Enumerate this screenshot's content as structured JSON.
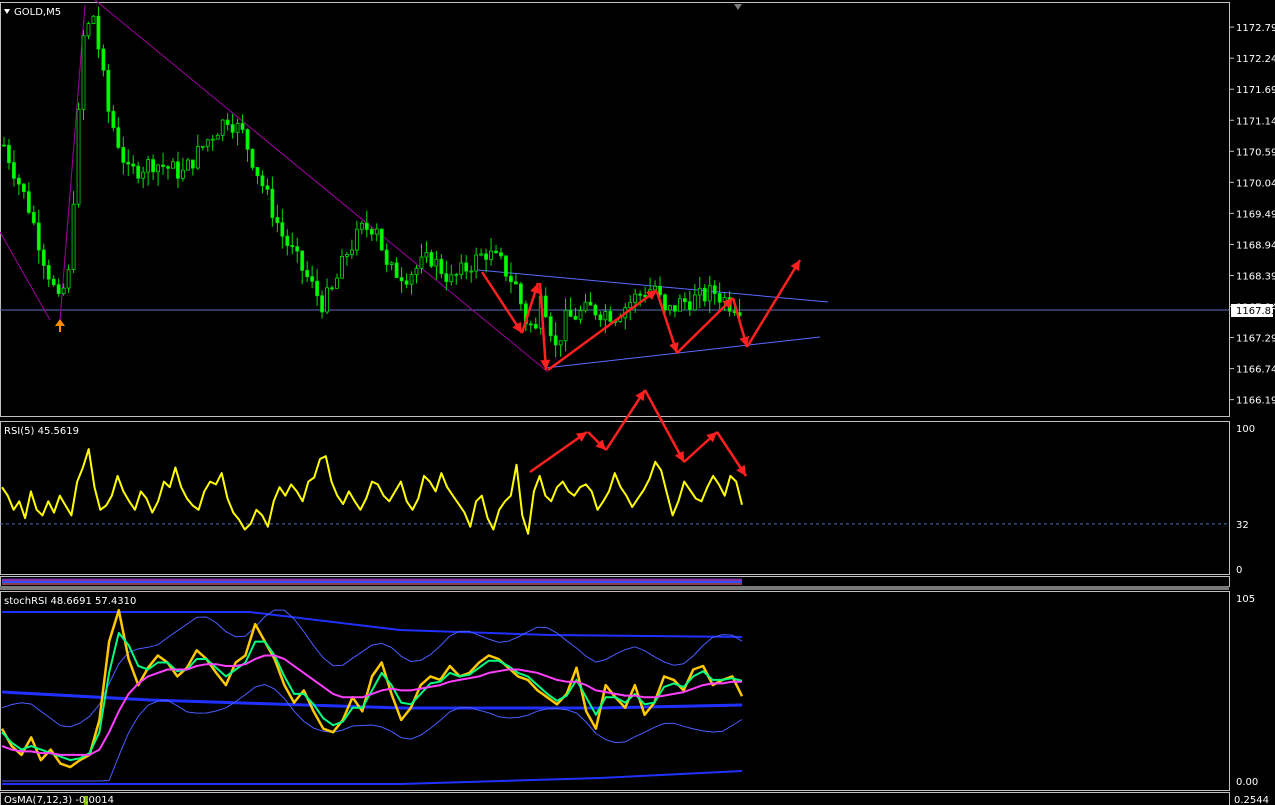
{
  "colors": {
    "background": "#000000",
    "frame": "#c0c0c0",
    "candle_up": "#00e000",
    "candle_down": "#00ff00",
    "trendline_blue": "#5a6aff",
    "trendline_magenta": "#a000a0",
    "bid_line": "#6070c0",
    "annotation_arrow": "#ff2020",
    "rsi_line": "#ffff00",
    "stoch_yellow": "#ffc800",
    "stoch_green": "#00ff80",
    "stoch_magenta": "#ff40ff",
    "stoch_band_thin": "#4a5cff",
    "stoch_band_thick": "#2030ff"
  },
  "chart_data": [
    {
      "type": "candlestick",
      "title": "GOLD,M5",
      "symbol": "GOLD",
      "timeframe": "M5",
      "ylim": [
        1165.9,
        1173.2
      ],
      "y_ticks": [
        1172.79,
        1172.24,
        1171.69,
        1171.14,
        1170.59,
        1170.04,
        1169.49,
        1168.94,
        1168.39,
        1167.84,
        1167.29,
        1166.74,
        1166.19
      ],
      "current_price_label": "1167.83",
      "current_price": 1167.83,
      "close_path": [
        [
          0,
          1170.7
        ],
        [
          5,
          1169.6
        ],
        [
          8,
          1168.7
        ],
        [
          11,
          1167.9
        ],
        [
          13,
          1168.4
        ],
        [
          16,
          1172.6
        ],
        [
          18,
          1173.0
        ],
        [
          21,
          1171.3
        ],
        [
          25,
          1170.2
        ],
        [
          30,
          1170.4
        ],
        [
          36,
          1170.2
        ],
        [
          41,
          1170.8
        ],
        [
          45,
          1171.2
        ],
        [
          48,
          1170.9
        ],
        [
          52,
          1170.0
        ],
        [
          56,
          1169.1
        ],
        [
          60,
          1168.5
        ],
        [
          64,
          1167.9
        ],
        [
          66,
          1168.1
        ],
        [
          69,
          1168.8
        ],
        [
          72,
          1169.2
        ],
        [
          75,
          1169.3
        ],
        [
          77,
          1168.5
        ],
        [
          81,
          1168.4
        ],
        [
          86,
          1168.7
        ],
        [
          90,
          1168.3
        ],
        [
          94,
          1168.6
        ],
        [
          97,
          1168.8
        ],
        [
          100,
          1168.6
        ],
        [
          103,
          1168.2
        ],
        [
          105,
          1167.6
        ],
        [
          107,
          1167.4
        ],
        [
          108,
          1168.2
        ],
        [
          111,
          1167.1
        ],
        [
          113,
          1167.6
        ],
        [
          118,
          1167.8
        ],
        [
          123,
          1167.7
        ],
        [
          127,
          1168.0
        ],
        [
          131,
          1168.2
        ],
        [
          133,
          1167.7
        ],
        [
          136,
          1167.9
        ],
        [
          140,
          1168.0
        ],
        [
          143,
          1168.1
        ],
        [
          146,
          1167.9
        ],
        [
          148,
          1167.85
        ]
      ],
      "annotations": {
        "trend_lines": "descending line from high, converging triangle lines",
        "arrows": "red zig-zag projection arrows"
      }
    },
    {
      "type": "line",
      "title": "RSI(5) 45.5619",
      "ylim": [
        0,
        100
      ],
      "y_ticks": [
        100,
        32,
        0
      ],
      "level_line": 32,
      "series": [
        {
          "name": "RSI(5)",
          "values": [
            58,
            52,
            42,
            48,
            36,
            55,
            42,
            38,
            48,
            40,
            52,
            45,
            38,
            62,
            72,
            85,
            58,
            42,
            45,
            52,
            66,
            55,
            48,
            42,
            55,
            50,
            40,
            48,
            62,
            58,
            72,
            58,
            50,
            45,
            42,
            55,
            62,
            60,
            68,
            50,
            40,
            35,
            28,
            32,
            42,
            38,
            30,
            48,
            58,
            52,
            60,
            55,
            48,
            62,
            65,
            78,
            80,
            62,
            52,
            46,
            55,
            48,
            42,
            50,
            62,
            60,
            52,
            48,
            55,
            62,
            48,
            42,
            50,
            66,
            62,
            55,
            68,
            58,
            52,
            46,
            40,
            30,
            48,
            52,
            36,
            28,
            42,
            48,
            52,
            74,
            38,
            25,
            55,
            66,
            52,
            48,
            58,
            62,
            55,
            52,
            58,
            60,
            55,
            42,
            48,
            55,
            68,
            58,
            52,
            44,
            50,
            56,
            64,
            76,
            70,
            54,
            38,
            48,
            62,
            56,
            50,
            48,
            58,
            66,
            60,
            52,
            66,
            62,
            45.56
          ]
        }
      ]
    },
    {
      "type": "line",
      "title": "stochRSI 48.6691 57.4310",
      "ylim": [
        0,
        105
      ],
      "y_ticks": [
        105,
        0
      ],
      "series": [
        {
          "name": "fast",
          "values": [
            30,
            20,
            15,
            25,
            12,
            18,
            10,
            8,
            12,
            15,
            35,
            80,
            98,
            70,
            55,
            65,
            72,
            68,
            60,
            65,
            75,
            70,
            62,
            55,
            68,
            72,
            90,
            80,
            70,
            55,
            45,
            52,
            40,
            30,
            28,
            35,
            48,
            40,
            60,
            68,
            50,
            35,
            42,
            55,
            60,
            58,
            66,
            60,
            62,
            68,
            72,
            70,
            65,
            60,
            58,
            52,
            48,
            44,
            50,
            65,
            40,
            30,
            55,
            48,
            42,
            55,
            38,
            45,
            60,
            58,
            52,
            64,
            66,
            55,
            58,
            60,
            48.67
          ]
        },
        {
          "name": "signal",
          "values": [
            28,
            22,
            18,
            20,
            18,
            16,
            14,
            12,
            13,
            16,
            28,
            62,
            85,
            78,
            66,
            64,
            68,
            68,
            63,
            64,
            70,
            70,
            65,
            60,
            64,
            68,
            80,
            80,
            72,
            60,
            50,
            50,
            44,
            36,
            32,
            34,
            42,
            42,
            52,
            62,
            55,
            45,
            44,
            50,
            56,
            57,
            62,
            60,
            61,
            65,
            69,
            69,
            66,
            62,
            60,
            55,
            50,
            46,
            49,
            58,
            48,
            38,
            48,
            48,
            45,
            50,
            44,
            45,
            54,
            56,
            54,
            60,
            63,
            58,
            58,
            59,
            57.43
          ]
        },
        {
          "name": "average",
          "values": [
            20,
            18,
            17,
            17,
            16,
            16,
            15,
            15,
            15,
            15,
            18,
            28,
            40,
            50,
            56,
            60,
            62,
            64,
            64,
            64,
            66,
            67,
            67,
            66,
            66,
            67,
            70,
            72,
            72,
            70,
            66,
            62,
            58,
            54,
            50,
            48,
            48,
            48,
            50,
            52,
            53,
            52,
            52,
            53,
            54,
            55,
            57,
            58,
            59,
            60,
            62,
            63,
            64,
            64,
            63,
            62,
            60,
            58,
            57,
            57,
            55,
            52,
            51,
            50,
            49,
            49,
            48,
            48,
            49,
            50,
            51,
            53,
            55,
            56,
            56,
            57,
            57
          ]
        }
      ]
    },
    {
      "type": "bar",
      "title": "OsMA(7,12,3) -0.0014",
      "y_ticks": [
        0.2544
      ]
    }
  ]
}
